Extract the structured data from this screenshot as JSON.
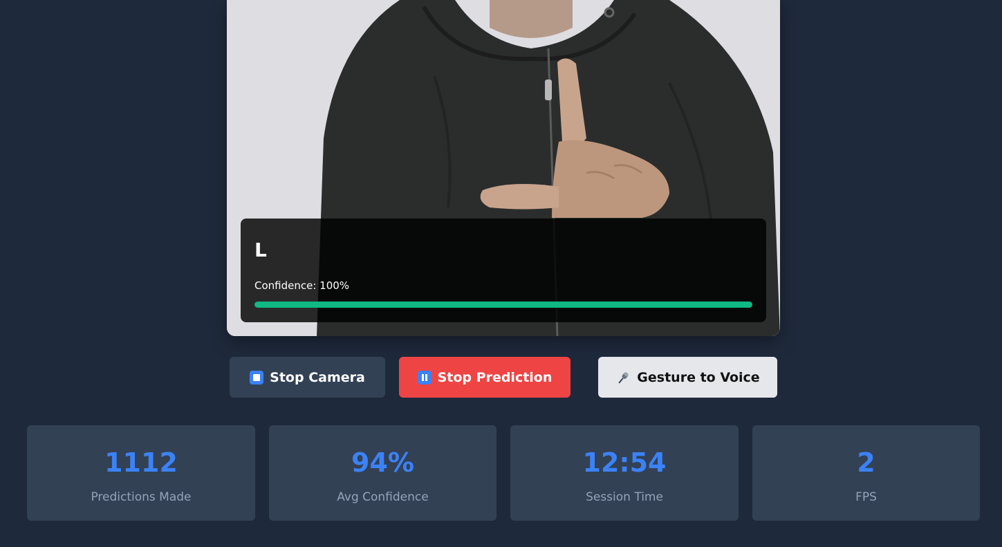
{
  "camera": {
    "prediction": {
      "letter": "L",
      "confidence_label": "Confidence: 100%",
      "confidence_fraction": 1.0,
      "bar_color": "#10b981"
    }
  },
  "controls": {
    "stop_camera": {
      "label": "Stop Camera",
      "icon": "stop-icon"
    },
    "stop_prediction": {
      "label": "Stop Prediction",
      "icon": "pause-icon"
    },
    "gesture_to_voice": {
      "label": "Gesture to Voice",
      "icon": "microphone-icon"
    }
  },
  "stats": [
    {
      "value": "1112",
      "label": "Predictions Made"
    },
    {
      "value": "94%",
      "label": "Avg Confidence"
    },
    {
      "value": "12:54",
      "label": "Session Time"
    },
    {
      "value": "2",
      "label": "FPS"
    }
  ],
  "colors": {
    "background": "#1e293b",
    "card": "#334155",
    "accent": "#3b82f6",
    "danger": "#ef4444"
  }
}
